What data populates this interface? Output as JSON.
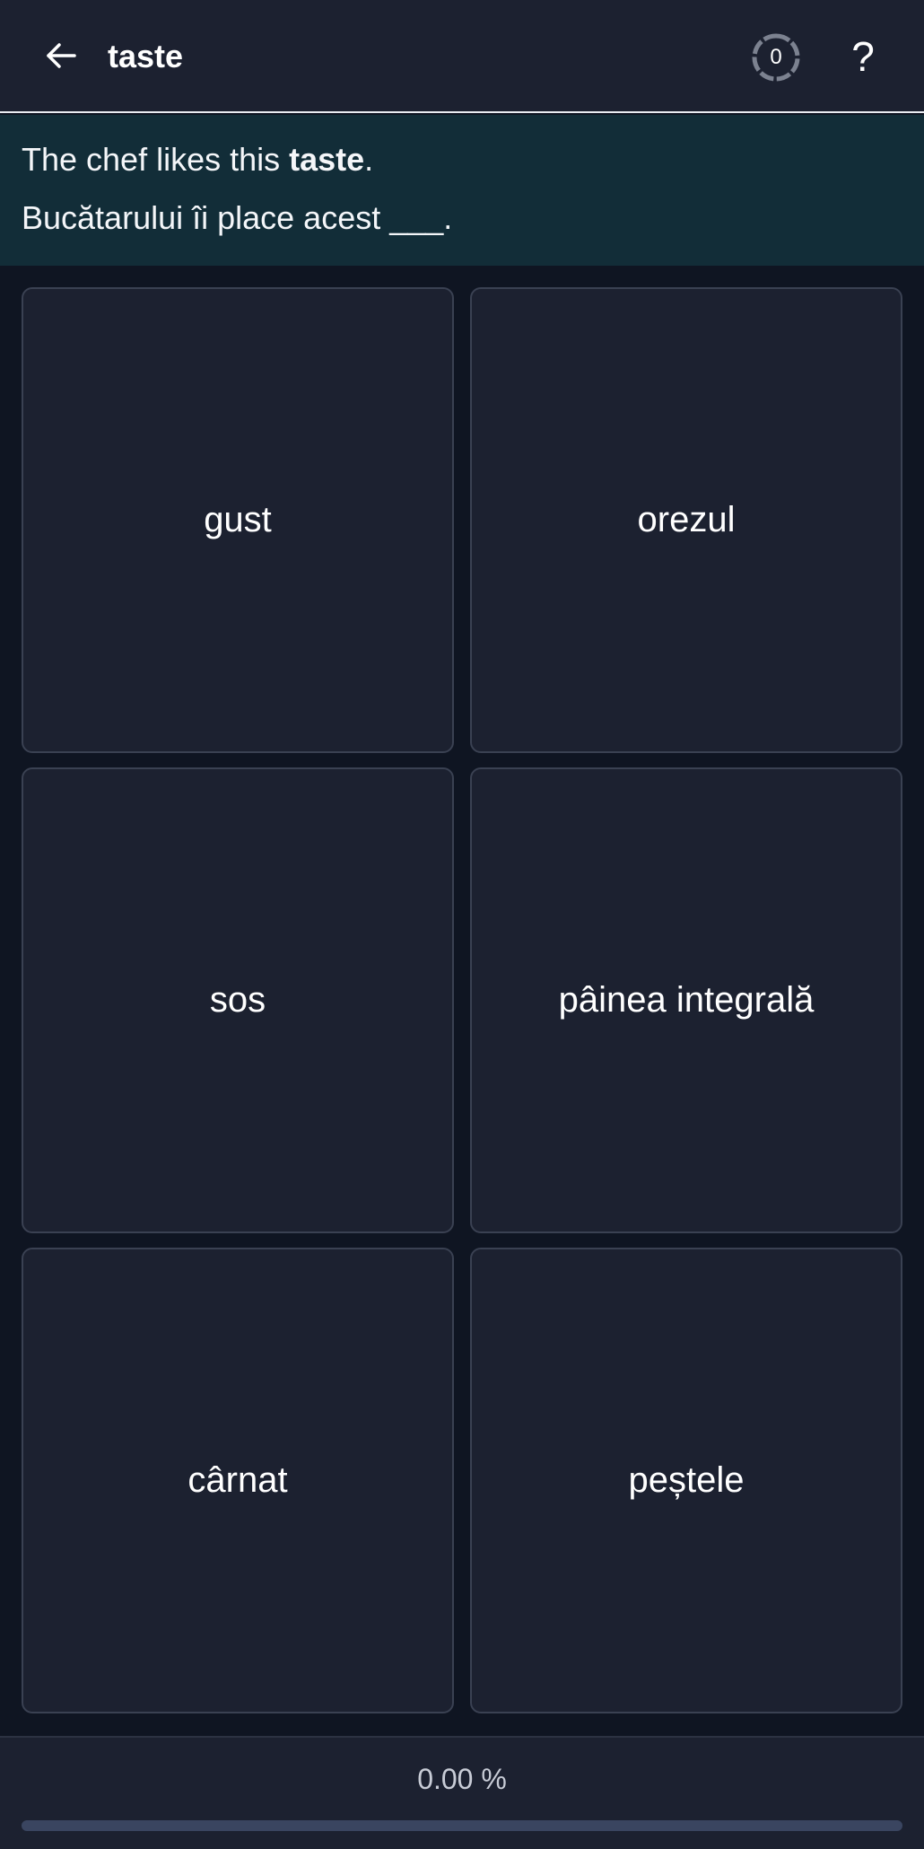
{
  "header": {
    "title": "taste",
    "timer_count": "0",
    "help_label": "?"
  },
  "prompt": {
    "sentence_before": "The chef likes this ",
    "sentence_bold": "taste",
    "sentence_after": ".",
    "translation": "Bucătarului îi place acest ___."
  },
  "options": [
    {
      "label": "gust"
    },
    {
      "label": "orezul"
    },
    {
      "label": "sos"
    },
    {
      "label": "pâinea integrală"
    },
    {
      "label": "cârnat"
    },
    {
      "label": "peștele"
    }
  ],
  "progress": {
    "label": "0.00 %",
    "fraction": 0
  },
  "colors": {
    "background": "#0f1522",
    "surface": "#1c2130",
    "prompt_background": "#122d38",
    "card_border": "#3a4152",
    "progress_track": "#3a4560"
  },
  "icons": {
    "back": "arrow-left-icon",
    "timer": "timer-ring-icon",
    "help": "question-mark-icon"
  }
}
